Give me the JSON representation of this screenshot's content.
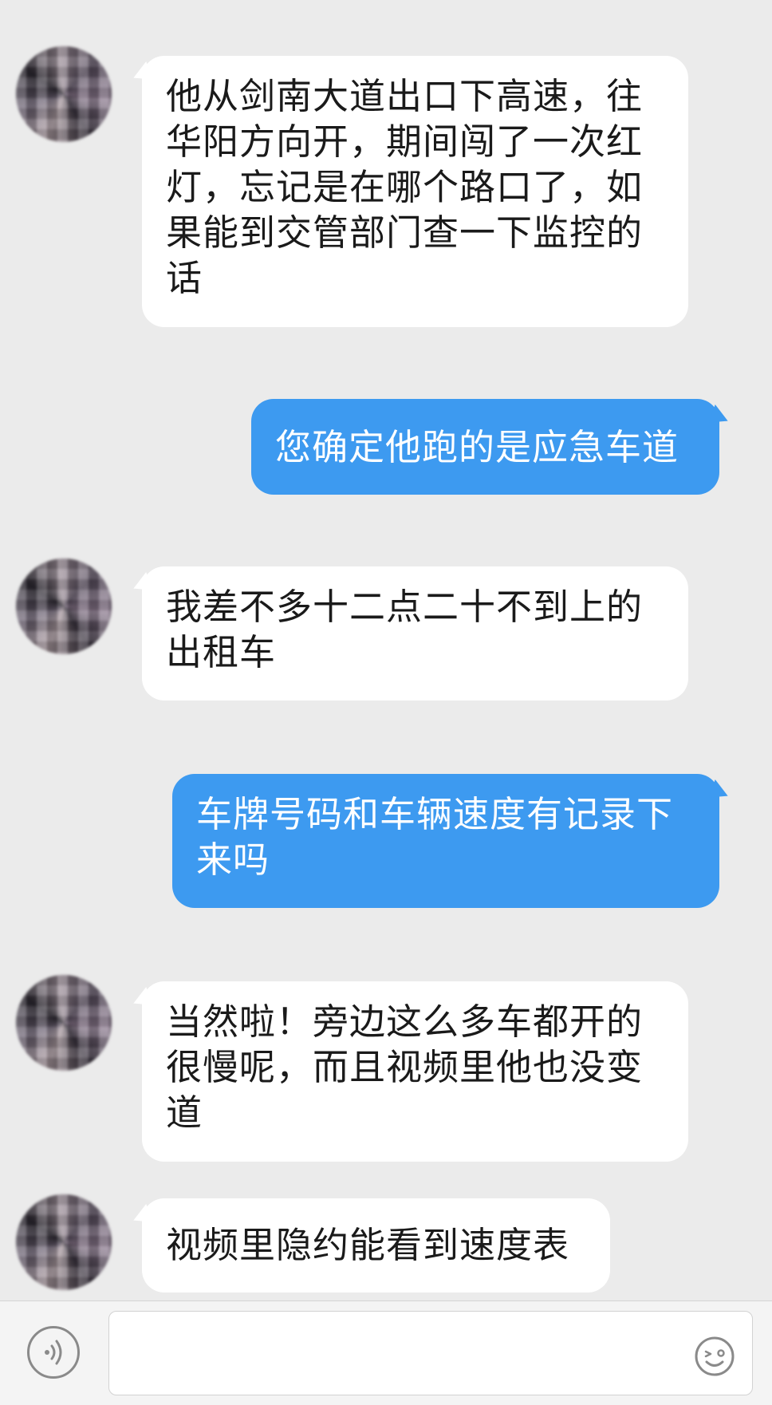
{
  "messages": [
    {
      "side": "in",
      "text": "他从剑南大道出口下高速，往华阳方向开，期间闯了一次红灯，忘记是在哪个路口了，如果能到交管部门查一下监控的话"
    },
    {
      "side": "out",
      "text": "您确定他跑的是应急车道"
    },
    {
      "side": "in",
      "text": "我差不多十二点二十不到上的出租车"
    },
    {
      "side": "out",
      "text": "车牌号码和车辆速度有记录下来吗"
    },
    {
      "side": "in",
      "text": "当然啦！旁边这么多车都开的很慢呢，而且视频里他也没变道"
    },
    {
      "side": "in",
      "text": "视频里隐约能看到速度表"
    }
  ],
  "input_bar": {
    "voice_icon": "voice-icon",
    "text_value": "",
    "emoji_icon": "emoji-icon"
  },
  "colors": {
    "background": "#ebebeb",
    "incoming_bubble": "#ffffff",
    "outgoing_bubble": "#3d9af0",
    "outgoing_text": "#ffffff"
  }
}
